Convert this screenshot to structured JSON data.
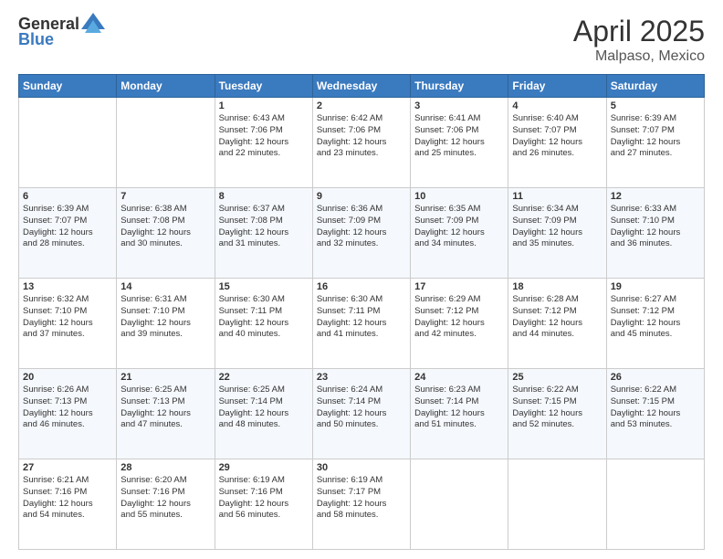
{
  "header": {
    "logo_general": "General",
    "logo_blue": "Blue",
    "title": "April 2025",
    "subtitle": "Malpaso, Mexico"
  },
  "columns": [
    "Sunday",
    "Monday",
    "Tuesday",
    "Wednesday",
    "Thursday",
    "Friday",
    "Saturday"
  ],
  "weeks": [
    [
      {
        "day": "",
        "info": ""
      },
      {
        "day": "",
        "info": ""
      },
      {
        "day": "1",
        "info": "Sunrise: 6:43 AM\nSunset: 7:06 PM\nDaylight: 12 hours\nand 22 minutes."
      },
      {
        "day": "2",
        "info": "Sunrise: 6:42 AM\nSunset: 7:06 PM\nDaylight: 12 hours\nand 23 minutes."
      },
      {
        "day": "3",
        "info": "Sunrise: 6:41 AM\nSunset: 7:06 PM\nDaylight: 12 hours\nand 25 minutes."
      },
      {
        "day": "4",
        "info": "Sunrise: 6:40 AM\nSunset: 7:07 PM\nDaylight: 12 hours\nand 26 minutes."
      },
      {
        "day": "5",
        "info": "Sunrise: 6:39 AM\nSunset: 7:07 PM\nDaylight: 12 hours\nand 27 minutes."
      }
    ],
    [
      {
        "day": "6",
        "info": "Sunrise: 6:39 AM\nSunset: 7:07 PM\nDaylight: 12 hours\nand 28 minutes."
      },
      {
        "day": "7",
        "info": "Sunrise: 6:38 AM\nSunset: 7:08 PM\nDaylight: 12 hours\nand 30 minutes."
      },
      {
        "day": "8",
        "info": "Sunrise: 6:37 AM\nSunset: 7:08 PM\nDaylight: 12 hours\nand 31 minutes."
      },
      {
        "day": "9",
        "info": "Sunrise: 6:36 AM\nSunset: 7:09 PM\nDaylight: 12 hours\nand 32 minutes."
      },
      {
        "day": "10",
        "info": "Sunrise: 6:35 AM\nSunset: 7:09 PM\nDaylight: 12 hours\nand 34 minutes."
      },
      {
        "day": "11",
        "info": "Sunrise: 6:34 AM\nSunset: 7:09 PM\nDaylight: 12 hours\nand 35 minutes."
      },
      {
        "day": "12",
        "info": "Sunrise: 6:33 AM\nSunset: 7:10 PM\nDaylight: 12 hours\nand 36 minutes."
      }
    ],
    [
      {
        "day": "13",
        "info": "Sunrise: 6:32 AM\nSunset: 7:10 PM\nDaylight: 12 hours\nand 37 minutes."
      },
      {
        "day": "14",
        "info": "Sunrise: 6:31 AM\nSunset: 7:10 PM\nDaylight: 12 hours\nand 39 minutes."
      },
      {
        "day": "15",
        "info": "Sunrise: 6:30 AM\nSunset: 7:11 PM\nDaylight: 12 hours\nand 40 minutes."
      },
      {
        "day": "16",
        "info": "Sunrise: 6:30 AM\nSunset: 7:11 PM\nDaylight: 12 hours\nand 41 minutes."
      },
      {
        "day": "17",
        "info": "Sunrise: 6:29 AM\nSunset: 7:12 PM\nDaylight: 12 hours\nand 42 minutes."
      },
      {
        "day": "18",
        "info": "Sunrise: 6:28 AM\nSunset: 7:12 PM\nDaylight: 12 hours\nand 44 minutes."
      },
      {
        "day": "19",
        "info": "Sunrise: 6:27 AM\nSunset: 7:12 PM\nDaylight: 12 hours\nand 45 minutes."
      }
    ],
    [
      {
        "day": "20",
        "info": "Sunrise: 6:26 AM\nSunset: 7:13 PM\nDaylight: 12 hours\nand 46 minutes."
      },
      {
        "day": "21",
        "info": "Sunrise: 6:25 AM\nSunset: 7:13 PM\nDaylight: 12 hours\nand 47 minutes."
      },
      {
        "day": "22",
        "info": "Sunrise: 6:25 AM\nSunset: 7:14 PM\nDaylight: 12 hours\nand 48 minutes."
      },
      {
        "day": "23",
        "info": "Sunrise: 6:24 AM\nSunset: 7:14 PM\nDaylight: 12 hours\nand 50 minutes."
      },
      {
        "day": "24",
        "info": "Sunrise: 6:23 AM\nSunset: 7:14 PM\nDaylight: 12 hours\nand 51 minutes."
      },
      {
        "day": "25",
        "info": "Sunrise: 6:22 AM\nSunset: 7:15 PM\nDaylight: 12 hours\nand 52 minutes."
      },
      {
        "day": "26",
        "info": "Sunrise: 6:22 AM\nSunset: 7:15 PM\nDaylight: 12 hours\nand 53 minutes."
      }
    ],
    [
      {
        "day": "27",
        "info": "Sunrise: 6:21 AM\nSunset: 7:16 PM\nDaylight: 12 hours\nand 54 minutes."
      },
      {
        "day": "28",
        "info": "Sunrise: 6:20 AM\nSunset: 7:16 PM\nDaylight: 12 hours\nand 55 minutes."
      },
      {
        "day": "29",
        "info": "Sunrise: 6:19 AM\nSunset: 7:16 PM\nDaylight: 12 hours\nand 56 minutes."
      },
      {
        "day": "30",
        "info": "Sunrise: 6:19 AM\nSunset: 7:17 PM\nDaylight: 12 hours\nand 58 minutes."
      },
      {
        "day": "",
        "info": ""
      },
      {
        "day": "",
        "info": ""
      },
      {
        "day": "",
        "info": ""
      }
    ]
  ]
}
